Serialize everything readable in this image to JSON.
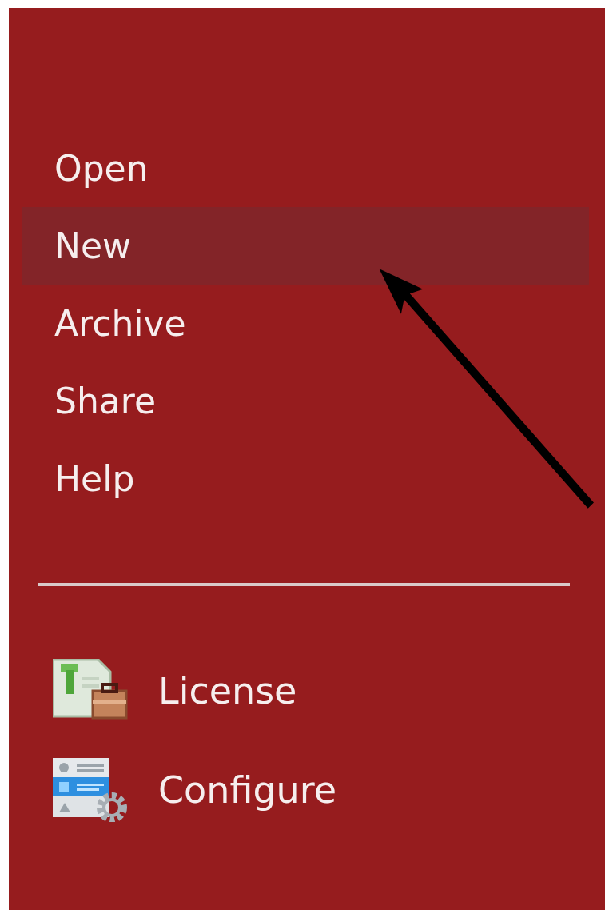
{
  "menu": [
    {
      "label": "Open",
      "selected": false
    },
    {
      "label": "New",
      "selected": true
    },
    {
      "label": "Archive",
      "selected": false
    },
    {
      "label": "Share",
      "selected": false
    },
    {
      "label": "Help",
      "selected": false
    }
  ],
  "tools": [
    {
      "label": "License",
      "kind": "license"
    },
    {
      "label": "Configure",
      "kind": "configure"
    }
  ],
  "annotation": {
    "kind": "arrow"
  }
}
